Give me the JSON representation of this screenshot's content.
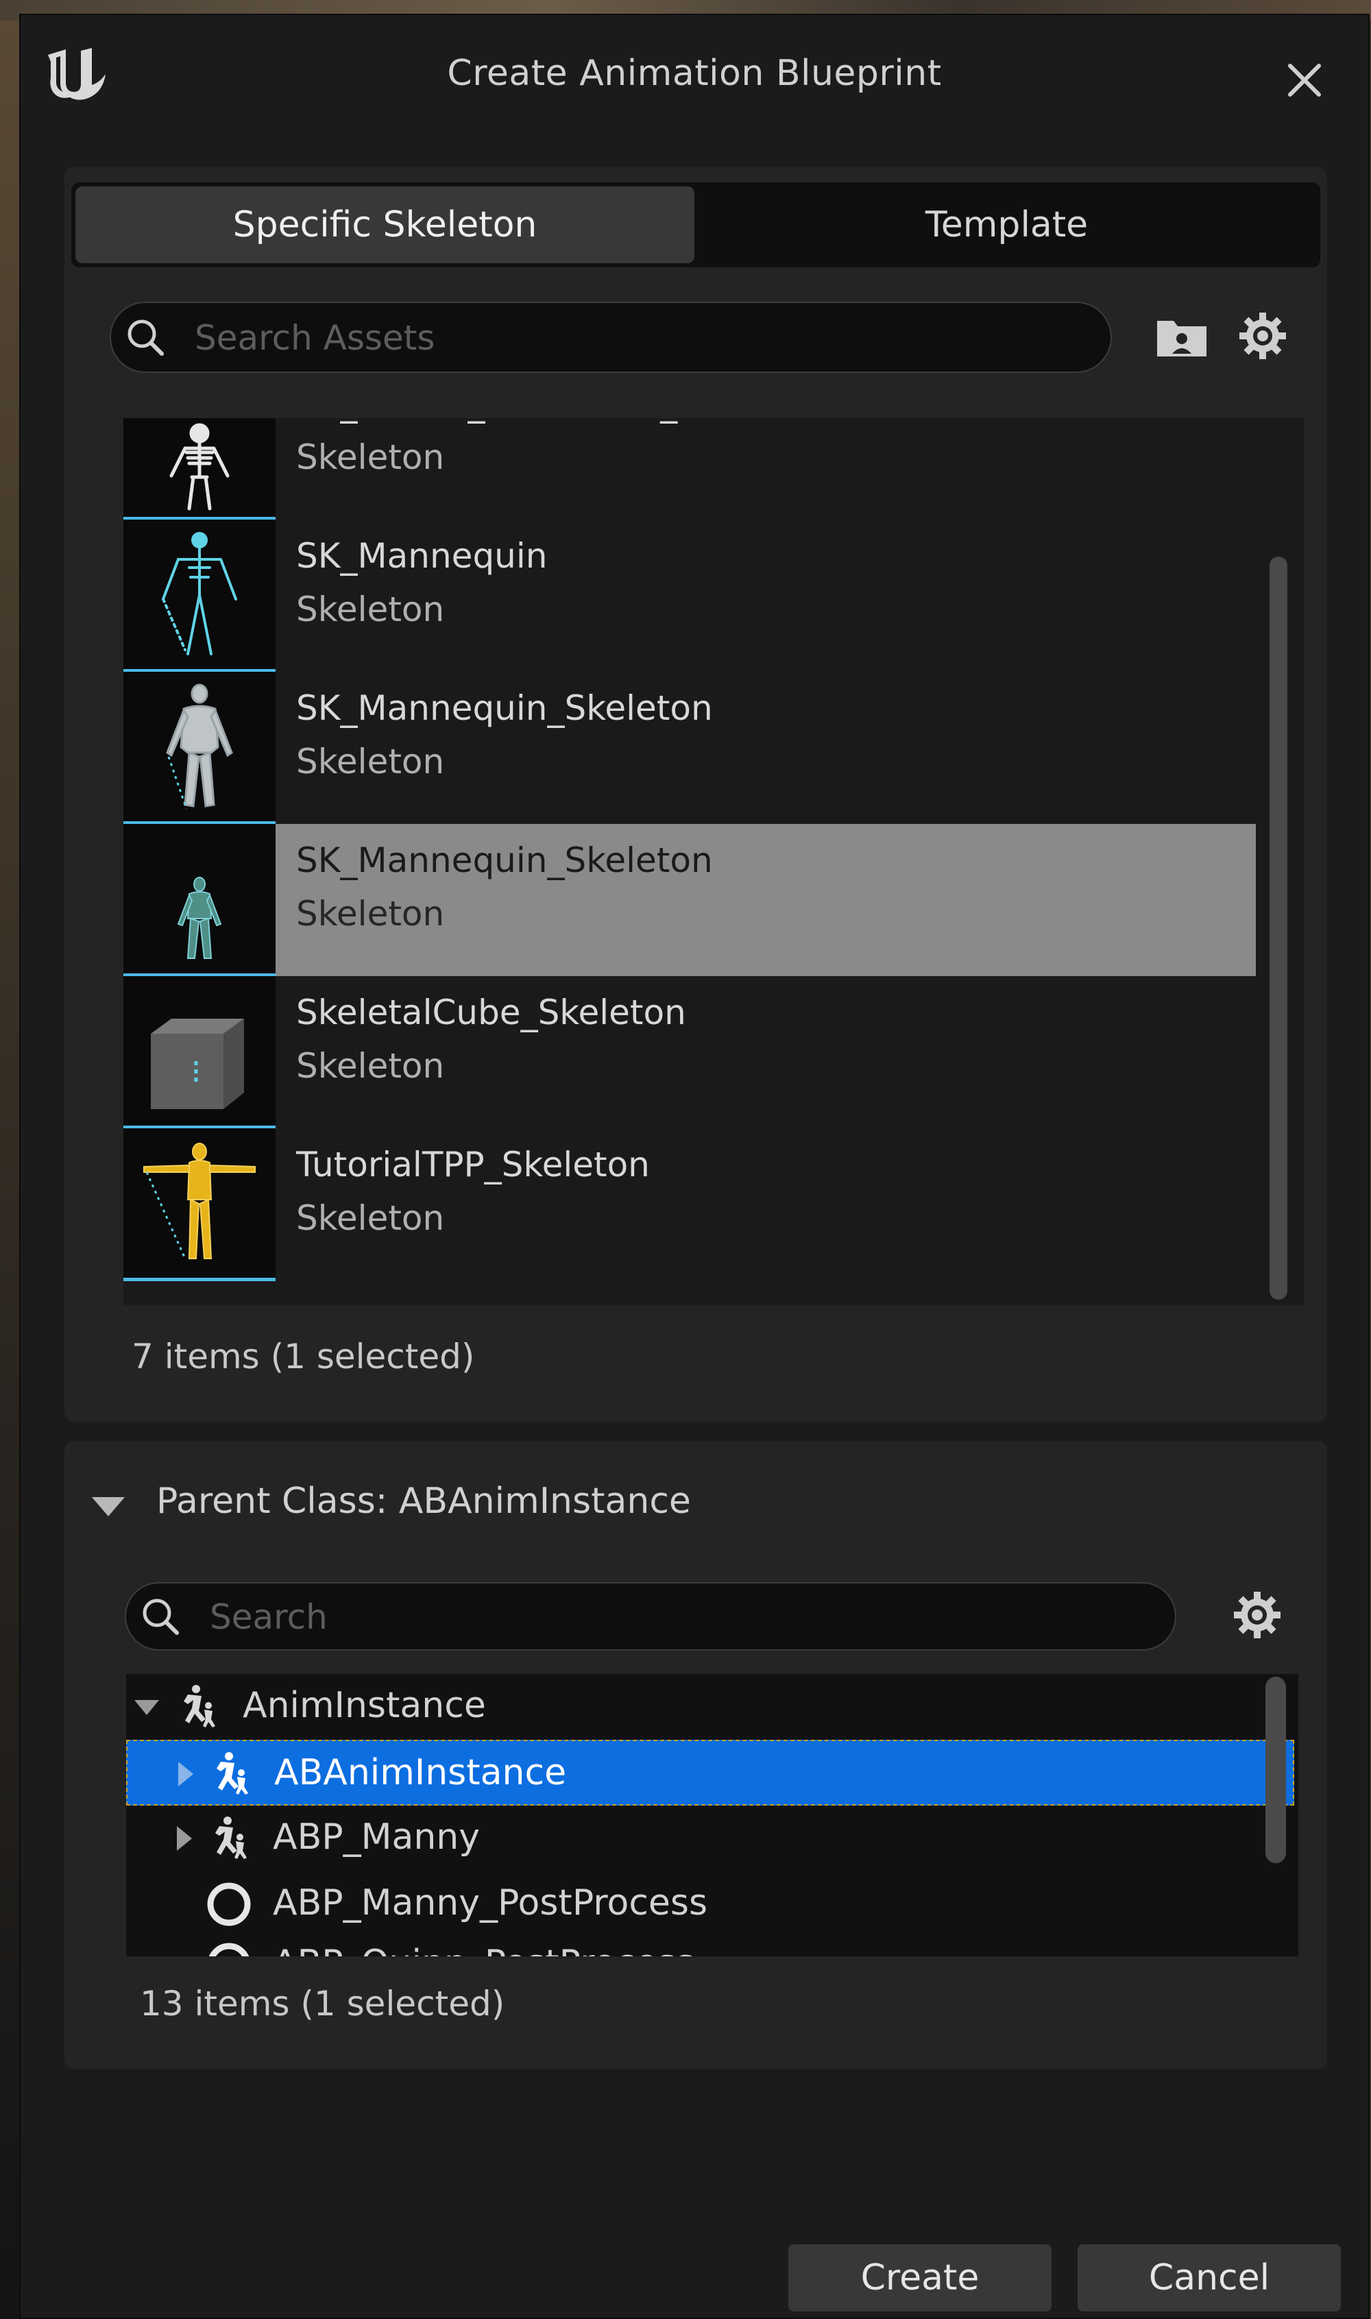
{
  "window": {
    "title": "Create Animation Blueprint"
  },
  "tabs": [
    {
      "label": "Specific Skeleton"
    },
    {
      "label": "Template"
    }
  ],
  "asset_search": {
    "placeholder": "Search Assets",
    "value": ""
  },
  "assets": [
    {
      "name": "SK_CharM_Barbarous_Skeleton",
      "type": "Skeleton",
      "thumbnail": "white-skeleton-icon"
    },
    {
      "name": "SK_Mannequin",
      "type": "Skeleton",
      "thumbnail": "cyan-wireframe-mannequin"
    },
    {
      "name": "SK_Mannequin_Skeleton",
      "type": "Skeleton",
      "thumbnail": "grey-mannequin"
    },
    {
      "name": "SK_Mannequin_Skeleton",
      "type": "Skeleton",
      "thumbnail": "teal-mannequin",
      "selected": true
    },
    {
      "name": "SkeletalCube_Skeleton",
      "type": "Skeleton",
      "thumbnail": "grey-cube"
    },
    {
      "name": "TutorialTPP_Skeleton",
      "type": "Skeleton",
      "thumbnail": "yellow-mannequin"
    }
  ],
  "asset_count": "7 items (1 selected)",
  "parent_class": {
    "label": "Parent Class: ABAnimInstance"
  },
  "class_search": {
    "placeholder": "Search",
    "value": ""
  },
  "classes": [
    {
      "name": "AnimInstance",
      "icon": "anim-instance-icon",
      "expanded": true
    },
    {
      "name": "ABAnimInstance",
      "icon": "anim-instance-icon",
      "selected": true
    },
    {
      "name": "ABP_Manny",
      "icon": "anim-instance-icon"
    },
    {
      "name": "ABP_Manny_PostProcess",
      "icon": "circle-icon"
    },
    {
      "name": "ABP_Quinn_PostProcess",
      "icon": "circle-icon"
    }
  ],
  "class_count": "13 items (1 selected)",
  "buttons": {
    "create": "Create",
    "cancel": "Cancel"
  },
  "colors": {
    "selection_blue": "#0d6ee0",
    "thumbnail_underline": "#4bbbe8",
    "asset_selected_bg": "#8a8a8a",
    "window_bg": "#1b1b1b"
  }
}
